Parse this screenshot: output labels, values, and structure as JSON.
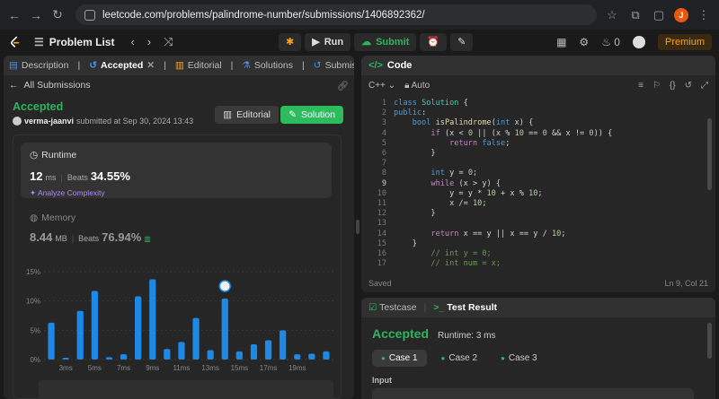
{
  "browser": {
    "url": "leetcode.com/problems/palindrome-number/submissions/1406892362/",
    "profile_initial": "J"
  },
  "topbar": {
    "problem_list": "Problem List",
    "run": "Run",
    "submit": "Submit",
    "streak": "0",
    "premium": "Premium"
  },
  "left_tabs": {
    "description": "Description",
    "accepted": "Accepted",
    "editorial": "Editorial",
    "solutions": "Solutions",
    "submissions": "Submissions"
  },
  "all_submissions": "All Submissions",
  "submission": {
    "status": "Accepted",
    "user": "verma-jaanvi",
    "submitted_text": "submitted at Sep 30, 2024 13:43",
    "editorial_btn": "Editorial",
    "solution_btn": "Solution"
  },
  "runtime": {
    "title": "Runtime",
    "value": "12",
    "unit": "ms",
    "beats_label": "Beats",
    "beats": "34.55%",
    "analyze": "Analyze Complexity"
  },
  "memory": {
    "title": "Memory",
    "value": "8.44",
    "unit": "MB",
    "beats_label": "Beats",
    "beats": "76.94%"
  },
  "chart_data": {
    "type": "bar",
    "ylim": [
      0,
      15
    ],
    "yticks": [
      "0%",
      "5%",
      "10%",
      "15%"
    ],
    "xticks": [
      "3ms",
      "5ms",
      "7ms",
      "9ms",
      "11ms",
      "13ms",
      "15ms",
      "17ms",
      "19ms"
    ],
    "values": [
      6.3,
      0.3,
      8.3,
      11.7,
      0.4,
      0.9,
      10.8,
      13.7,
      1.8,
      3.0,
      7.1,
      1.6,
      10.4,
      1.4,
      2.6,
      3.3,
      5.0,
      0.9,
      1.0,
      1.4
    ],
    "highlight_index": 12,
    "color": "#1e88e5"
  },
  "code_panel": {
    "title": "Code",
    "language": "C++",
    "auto": "Auto",
    "saved": "Saved",
    "cursor": "Ln 9, Col 21",
    "line_numbers": [
      "1",
      "2",
      "3",
      "4",
      "5",
      "6",
      "7",
      "8",
      "9",
      "10",
      "11",
      "12",
      "13",
      "14",
      "15",
      "16",
      "17"
    ]
  },
  "result_panel": {
    "testcase_tab": "Testcase",
    "result_tab": "Test Result",
    "status": "Accepted",
    "runtime": "Runtime: 3 ms",
    "cases": [
      "Case 1",
      "Case 2",
      "Case 3"
    ],
    "input_label": "Input"
  }
}
